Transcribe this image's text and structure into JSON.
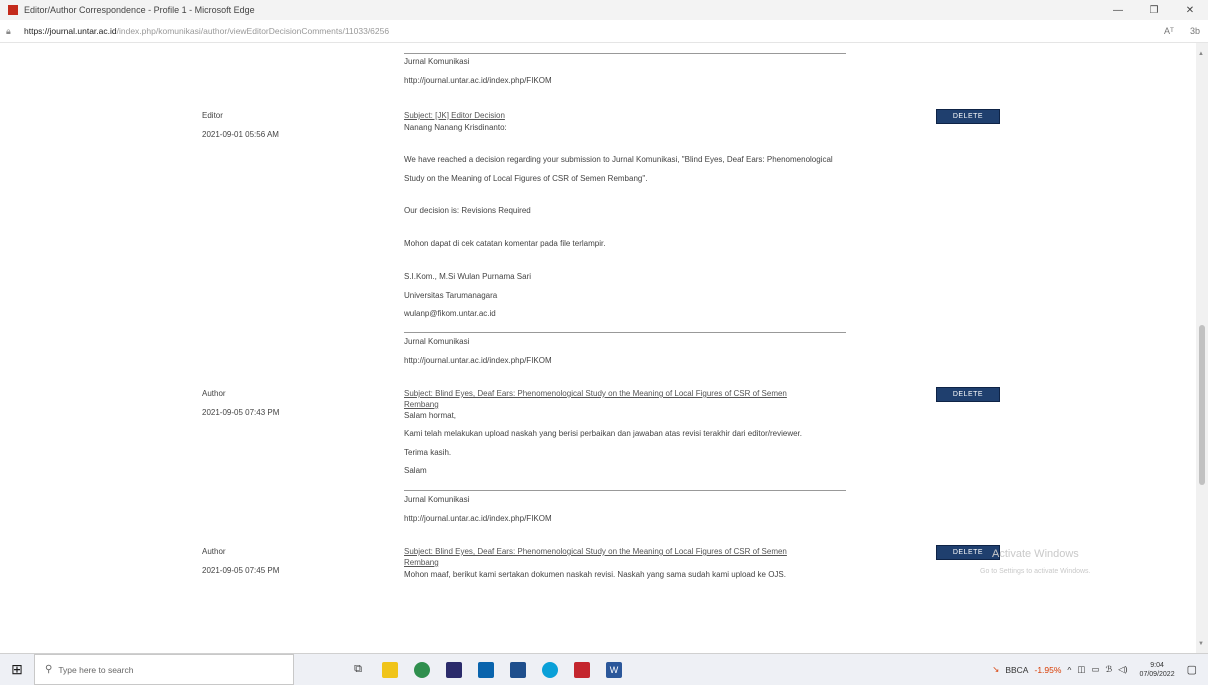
{
  "window": {
    "title": "Editor/Author Correspondence - Profile 1 - Microsoft Edge",
    "minimize_icon": "minimize-icon",
    "restore_icon": "restore-icon",
    "close_icon": "close-icon"
  },
  "address": {
    "domain": "https://journal.untar.ac.id",
    "path": "/index.php/komunikasi/author/viewEditorDecisionComments/11033/6256",
    "lock_icon": "lock-icon",
    "read_aloud": "Aᵀ",
    "extensions": "3b"
  },
  "messages": [
    {
      "sig_journal": "Jurnal Komunikasi",
      "sig_url": "http://journal.untar.ac.id/index.php/FIKOM"
    },
    {
      "role": "Editor",
      "date": "2021-09-01 05:56 AM",
      "subject": "Subject: [JK] Editor Decision",
      "delete": "DELETE",
      "body": [
        "Nanang Nanang Krisdinanto:",
        "We have reached a decision regarding your submission to Jurnal Komunikasi, \"Blind Eyes, Deaf Ears: Phenomenological",
        "Study on the Meaning of Local Figures of CSR of Semen Rembang\".",
        "Our decision is: Revisions Required",
        "Mohon dapat di cek catatan komentar pada file terlampir.",
        "S.I.Kom., M.Si Wulan Purnama Sari",
        "Universitas Tarumanagara",
        "wulanp@fikom.untar.ac.id"
      ],
      "sig_journal": "Jurnal Komunikasi",
      "sig_url": "http://journal.untar.ac.id/index.php/FIKOM"
    },
    {
      "role": "Author",
      "date": "2021-09-05 07:43 PM",
      "subject_line1": "Subject: Blind Eyes, Deaf Ears: Phenomenological Study on the Meaning of Local Figures of CSR of Semen",
      "subject_line2": "Rembang",
      "delete": "DELETE",
      "body": [
        "Salam hormat,",
        "Kami telah melakukan upload naskah yang berisi perbaikan dan jawaban atas revisi terakhir dari editor/reviewer.",
        "Terima kasih.",
        "Salam"
      ],
      "sig_journal": "Jurnal Komunikasi",
      "sig_url": "http://journal.untar.ac.id/index.php/FIKOM"
    },
    {
      "role": "Author",
      "date": "2021-09-05 07:45 PM",
      "subject_line1": "Subject: Blind Eyes, Deaf Ears: Phenomenological Study on the Meaning of Local Figures of CSR of Semen",
      "subject_line2": "Rembang",
      "delete": "DELETE",
      "body": [
        "Mohon maaf, berikut kami sertakan dokumen naskah revisi. Naskah yang sama sudah kami upload ke OJS."
      ]
    }
  ],
  "watermark": {
    "title": "Activate Windows",
    "subtitle": "Go to Settings to activate Windows."
  },
  "taskbar": {
    "search_placeholder": "Type here to search",
    "stock": "BBCA",
    "stock_change": "-1.95%",
    "time": "9:04",
    "date": "07/09/2022"
  },
  "colors": {
    "delete_button": "#1f3f6e",
    "stock_change": "#d83b01"
  }
}
